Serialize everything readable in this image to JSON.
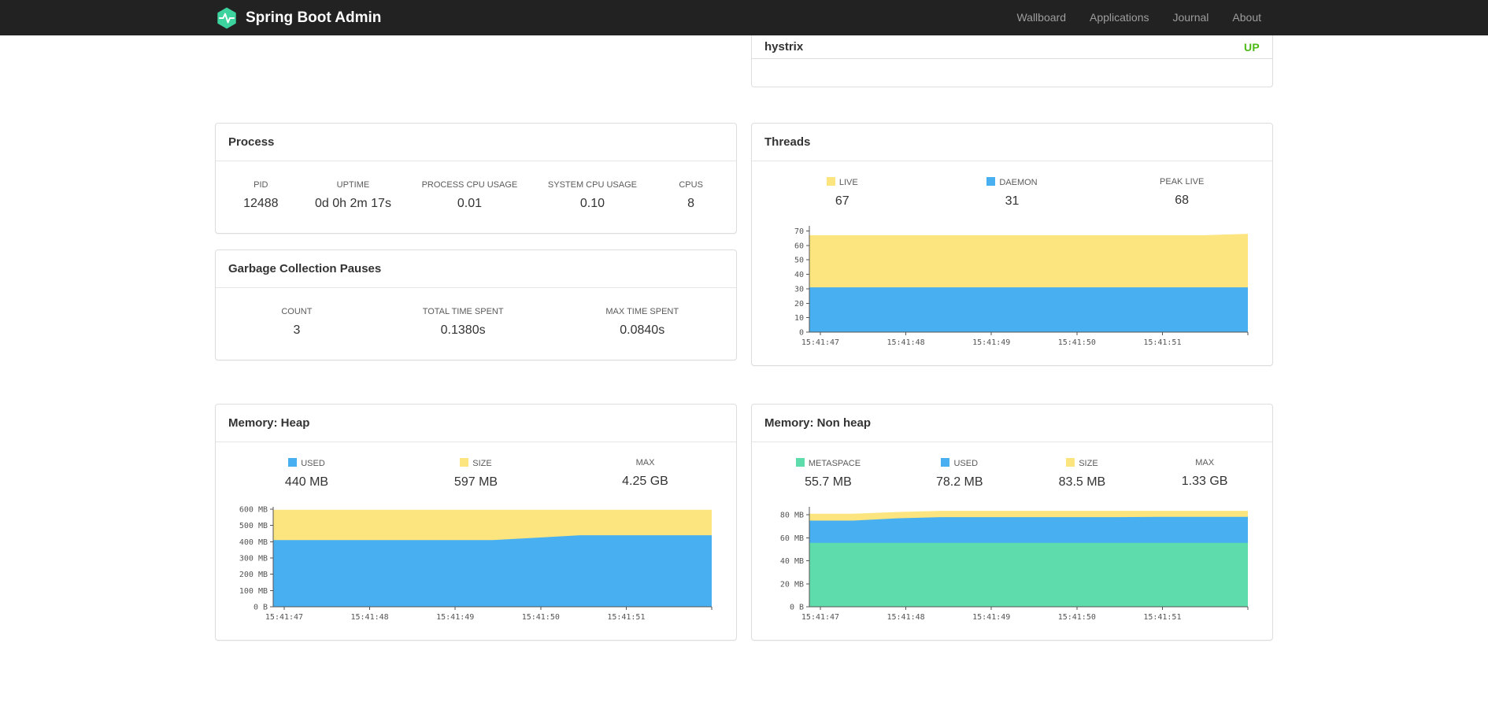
{
  "navbar": {
    "brand": "Spring Boot Admin",
    "brand_color": "#3dd39f",
    "links": [
      "Wallboard",
      "Applications",
      "Journal",
      "About"
    ]
  },
  "services_panel": {
    "rows": [
      {
        "name": "hystrix",
        "status": "UP",
        "status_color": "#4cbb17"
      }
    ]
  },
  "panels": {
    "process": {
      "title": "Process",
      "metrics": [
        {
          "label": "PID",
          "value": "12488"
        },
        {
          "label": "UPTIME",
          "value": "0d 0h 2m 17s"
        },
        {
          "label": "PROCESS CPU USAGE",
          "value": "0.01"
        },
        {
          "label": "SYSTEM CPU USAGE",
          "value": "0.10"
        },
        {
          "label": "CPUS",
          "value": "8"
        }
      ]
    },
    "gc": {
      "title": "Garbage Collection Pauses",
      "metrics": [
        {
          "label": "COUNT",
          "value": "3"
        },
        {
          "label": "TOTAL TIME SPENT",
          "value": "0.1380s"
        },
        {
          "label": "MAX TIME SPENT",
          "value": "0.0840s"
        }
      ]
    },
    "threads": {
      "title": "Threads",
      "legend": [
        {
          "label": "LIVE",
          "value": "67",
          "swatch": "#fce57e"
        },
        {
          "label": "DAEMON",
          "value": "31",
          "swatch": "#48aff0"
        },
        {
          "label": "PEAK LIVE",
          "value": "68"
        }
      ]
    },
    "heap": {
      "title": "Memory: Heap",
      "legend": [
        {
          "label": "USED",
          "value": "440 MB",
          "swatch": "#48aff0"
        },
        {
          "label": "SIZE",
          "value": "597 MB",
          "swatch": "#fce57e"
        },
        {
          "label": "MAX",
          "value": "4.25 GB"
        }
      ]
    },
    "nonheap": {
      "title": "Memory: Non heap",
      "legend": [
        {
          "label": "METASPACE",
          "value": "55.7 MB",
          "swatch": "#5fdcab"
        },
        {
          "label": "USED",
          "value": "78.2 MB",
          "swatch": "#48aff0"
        },
        {
          "label": "SIZE",
          "value": "83.5 MB",
          "swatch": "#fce57e"
        },
        {
          "label": "MAX",
          "value": "1.33 GB"
        }
      ]
    }
  },
  "chart_data": {
    "threads": {
      "type": "area",
      "title": "Threads",
      "x_labels": [
        "15:41:47",
        "15:41:48",
        "15:41:49",
        "15:41:50",
        "15:41:51"
      ],
      "y_max": 73.5,
      "y_ticks": [
        {
          "v": 0,
          "label": "0"
        },
        {
          "v": 10,
          "label": "10"
        },
        {
          "v": 20,
          "label": "20"
        },
        {
          "v": 30,
          "label": "30"
        },
        {
          "v": 40,
          "label": "40"
        },
        {
          "v": 50,
          "label": "50"
        },
        {
          "v": 60,
          "label": "60"
        },
        {
          "v": 70,
          "label": "70"
        }
      ],
      "series": [
        {
          "name": "LIVE",
          "color": "#fce57e",
          "values": [
            67,
            67,
            67,
            67,
            67,
            67,
            67,
            67,
            67,
            67,
            68
          ]
        },
        {
          "name": "DAEMON",
          "color": "#48aff0",
          "values": [
            31,
            31,
            31,
            31,
            31,
            31,
            31,
            31,
            31,
            31,
            31
          ]
        }
      ]
    },
    "heap": {
      "type": "area",
      "title": "Memory: Heap",
      "x_labels": [
        "15:41:47",
        "15:41:48",
        "15:41:49",
        "15:41:50",
        "15:41:51"
      ],
      "y_max": 615,
      "y_ticks": [
        {
          "v": 0,
          "label": "0 B"
        },
        {
          "v": 100,
          "label": "100 MB"
        },
        {
          "v": 200,
          "label": "200 MB"
        },
        {
          "v": 300,
          "label": "300 MB"
        },
        {
          "v": 400,
          "label": "400 MB"
        },
        {
          "v": 500,
          "label": "500 MB"
        },
        {
          "v": 600,
          "label": "600 MB"
        }
      ],
      "series": [
        {
          "name": "SIZE",
          "color": "#fce57e",
          "values": [
            597,
            597,
            597,
            597,
            597,
            597,
            597,
            597,
            597,
            597,
            597
          ]
        },
        {
          "name": "USED",
          "color": "#48aff0",
          "values": [
            410,
            410,
            410,
            410,
            410,
            410,
            425,
            440,
            440,
            440,
            440
          ]
        }
      ]
    },
    "nonheap": {
      "type": "area",
      "title": "Memory: Non heap",
      "x_labels": [
        "15:41:47",
        "15:41:48",
        "15:41:49",
        "15:41:50",
        "15:41:51"
      ],
      "y_max": 87,
      "y_ticks": [
        {
          "v": 0,
          "label": "0 B"
        },
        {
          "v": 20,
          "label": "20 MB"
        },
        {
          "v": 40,
          "label": "40 MB"
        },
        {
          "v": 60,
          "label": "60 MB"
        },
        {
          "v": 80,
          "label": "80 MB"
        }
      ],
      "series": [
        {
          "name": "SIZE",
          "color": "#fce57e",
          "values": [
            81,
            81,
            82.5,
            83.5,
            83.5,
            83.5,
            83.5,
            83.5,
            83.5,
            83.5,
            83.5
          ]
        },
        {
          "name": "USED",
          "color": "#48aff0",
          "values": [
            75,
            75,
            77,
            78,
            78,
            78,
            78,
            78,
            78.2,
            78.2,
            78.2
          ]
        },
        {
          "name": "METASPACE",
          "color": "#5fdcab",
          "values": [
            55.7,
            55.7,
            55.7,
            55.7,
            55.7,
            55.7,
            55.7,
            55.7,
            55.7,
            55.7,
            55.7
          ]
        }
      ]
    }
  }
}
